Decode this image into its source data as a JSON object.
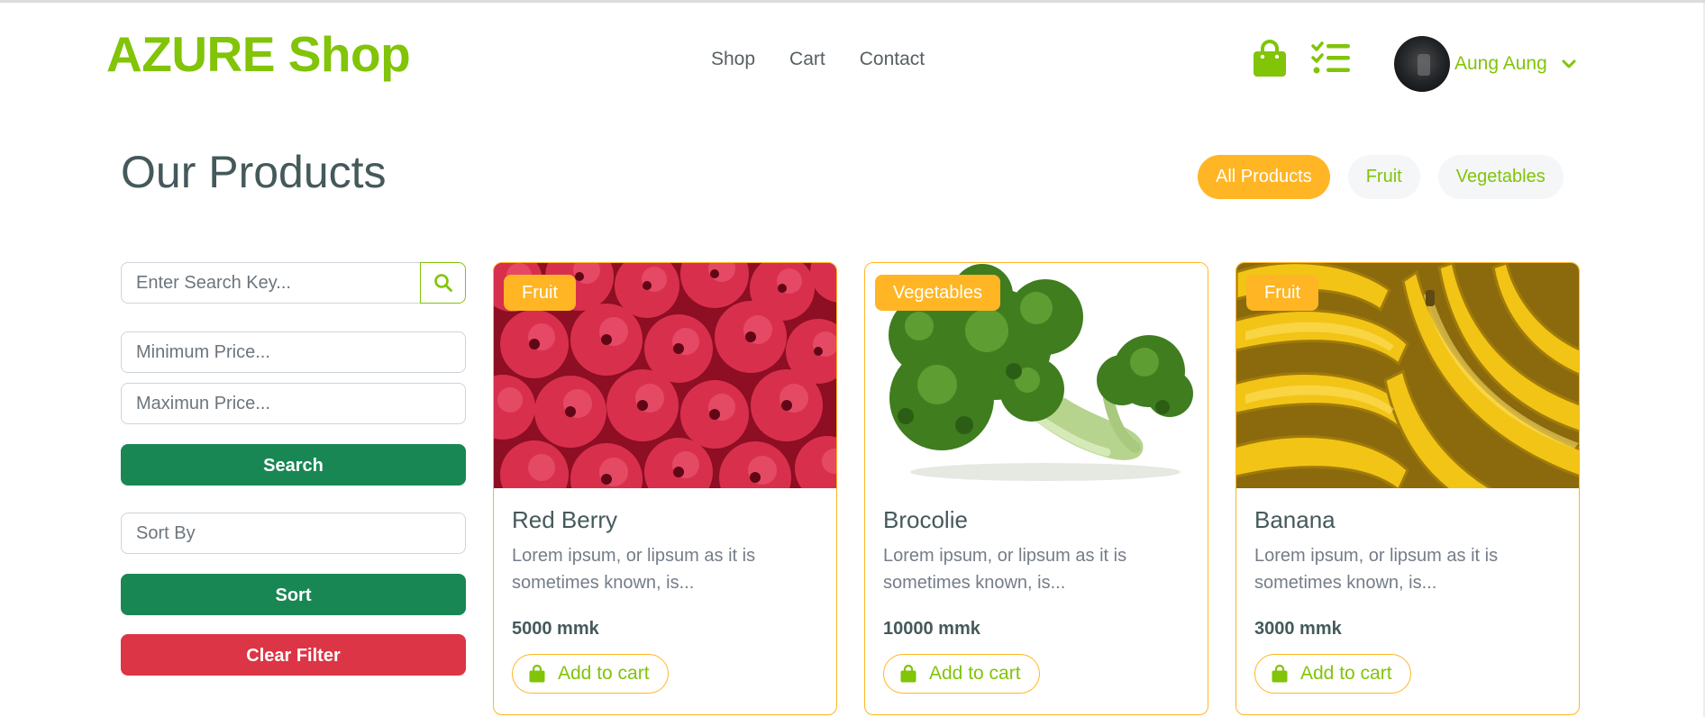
{
  "header": {
    "brand": "AZURE Shop",
    "nav": [
      "Shop",
      "Cart",
      "Contact"
    ],
    "user_name": "Aung Aung",
    "icons": {
      "bag": "shopping-bag-icon",
      "orders": "checklist-icon",
      "user_menu": "chevron-down-icon"
    }
  },
  "main": {
    "title": "Our Products",
    "filters": [
      "All Products",
      "Fruit",
      "Vegetables"
    ],
    "active_filter": "All Products"
  },
  "sidebar": {
    "search_placeholder": "Enter Search Key...",
    "min_price_placeholder": "Minimum Price...",
    "max_price_placeholder": "Maximun Price...",
    "search_label": "Search",
    "sort_placeholder": "Sort By",
    "sort_label": "Sort",
    "clear_label": "Clear Filter"
  },
  "products": [
    {
      "name": "Red Berry",
      "category": "Fruit",
      "description": "Lorem ipsum, or lipsum as it is sometimes known, is...",
      "price": "5000 mmk",
      "cta": "Add to cart",
      "image": "raspberries-photo"
    },
    {
      "name": "Brocolie",
      "category": "Vegetables",
      "description": "Lorem ipsum, or lipsum as it is sometimes known, is...",
      "price": "10000 mmk",
      "cta": "Add to cart",
      "image": "broccoli-photo"
    },
    {
      "name": "Banana",
      "category": "Fruit",
      "description": "Lorem ipsum, or lipsum as it is sometimes known, is...",
      "price": "3000 mmk",
      "cta": "Add to cart",
      "image": "bananas-photo"
    }
  ],
  "colors": {
    "brand": "#81c408",
    "accent": "#ffb524",
    "text": "#45595b",
    "success": "#198754",
    "danger": "#dc3545"
  }
}
